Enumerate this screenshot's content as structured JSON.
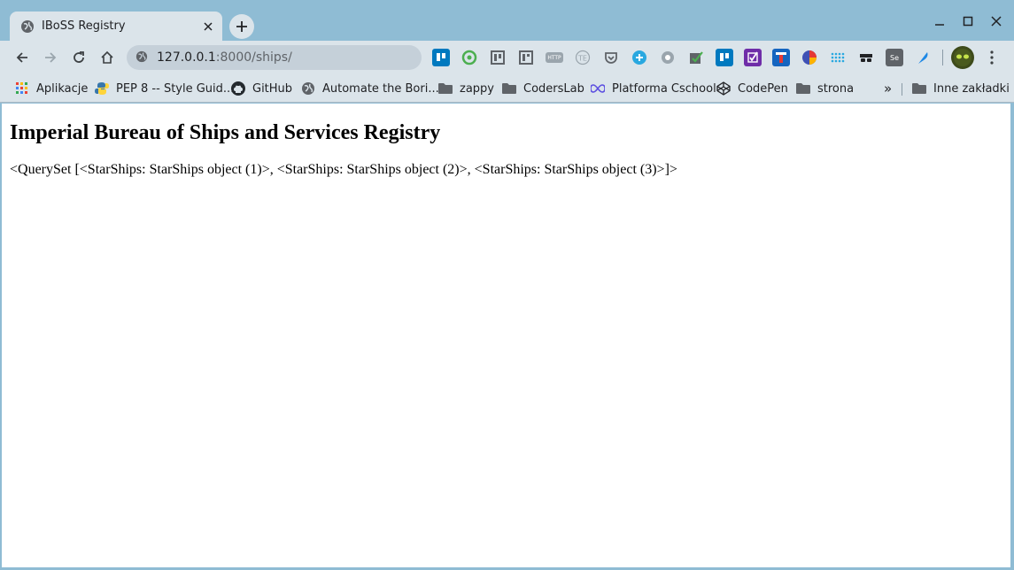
{
  "browser": {
    "tab": {
      "title": "IBoSS Registry"
    },
    "address_bar": {
      "host": "127.0.0.1",
      "path": ":8000/ships/"
    },
    "bookmarks": [
      {
        "label": "Aplikacje",
        "icon": "apps-grid-icon"
      },
      {
        "label": "PEP 8 -- Style Guid...",
        "icon": "python-icon"
      },
      {
        "label": "GitHub",
        "icon": "github-icon"
      },
      {
        "label": "Automate the Bori...",
        "icon": "globe-icon"
      },
      {
        "label": "zappy",
        "icon": "folder-icon"
      },
      {
        "label": "CodersLab",
        "icon": "folder-icon"
      },
      {
        "label": "Platforma Cschool",
        "icon": "infinity-icon"
      },
      {
        "label": "CodePen",
        "icon": "codepen-icon"
      },
      {
        "label": "strona",
        "icon": "folder-icon"
      }
    ],
    "bookmarks_overflow": "»",
    "other_bookmarks": "Inne zakładki"
  },
  "page": {
    "heading": "Imperial Bureau of Ships and Services Registry",
    "body_text": "<QuerySet [<StarShips: StarShips object (1)>, <StarShips: StarShips object (2)>, <StarShips: StarShips object (3)>]>"
  },
  "colors": {
    "tabstrip": "#8fbcd4",
    "toolbar": "#dbe4ea",
    "omnibox": "#c5d0d9",
    "page_bg": "#ffffff"
  }
}
